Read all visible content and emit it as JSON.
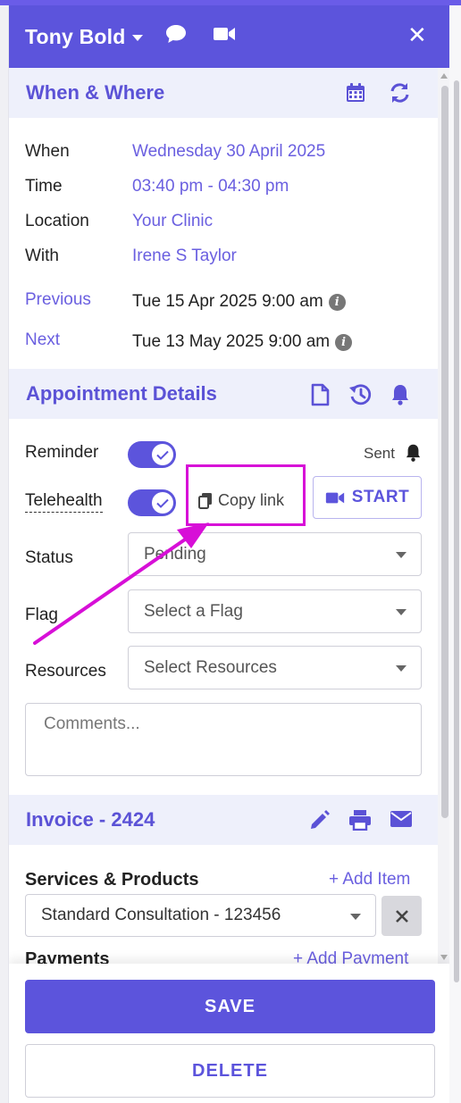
{
  "header": {
    "patient_name": "Tony Bold",
    "icons": [
      "chat-bubble-icon",
      "video-camera-icon",
      "close-icon"
    ],
    "close_glyph": "✕"
  },
  "when_where": {
    "title": "When & Where",
    "icons": [
      "calendar-icon",
      "refresh-icon"
    ],
    "rows": {
      "when": {
        "label": "When",
        "value": "Wednesday 30 April 2025"
      },
      "time": {
        "label": "Time",
        "value": "03:40 pm - 04:30 pm"
      },
      "location": {
        "label": "Location",
        "value": "Your Clinic"
      },
      "with": {
        "label": "With",
        "value": "Irene S Taylor"
      },
      "previous": {
        "label": "Previous",
        "value": "Tue 15 Apr 2025 9:00 am"
      },
      "next": {
        "label": "Next",
        "value": "Tue 13 May 2025 9:00 am"
      }
    }
  },
  "appointment": {
    "title": "Appointment Details",
    "icons": [
      "document-icon",
      "history-icon",
      "bell-icon"
    ],
    "reminder": {
      "label": "Reminder",
      "on": true,
      "status": "Sent"
    },
    "telehealth": {
      "label": "Telehealth",
      "on": true,
      "copy_link": "Copy link",
      "start": "START"
    },
    "status": {
      "label": "Status",
      "value": "Pending"
    },
    "flag": {
      "label": "Flag",
      "placeholder": "Select a Flag"
    },
    "resources": {
      "label": "Resources",
      "placeholder": "Select Resources"
    },
    "comments_placeholder": "Comments..."
  },
  "invoice": {
    "title": "Invoice - 2424",
    "icons": [
      "pencil-icon",
      "printer-icon",
      "envelope-icon"
    ],
    "services_label": "Services & Products",
    "add_item": "+ Add Item",
    "service_value": "Standard Consultation - 123456",
    "payments_label": "Payments",
    "add_payment": "+ Add Payment"
  },
  "footer": {
    "save": "SAVE",
    "delete": "DELETE"
  },
  "colors": {
    "accent": "#5c54dc",
    "link": "#6a5fe0",
    "section_bg": "#eef0fb",
    "annotation": "#d70fd7"
  }
}
